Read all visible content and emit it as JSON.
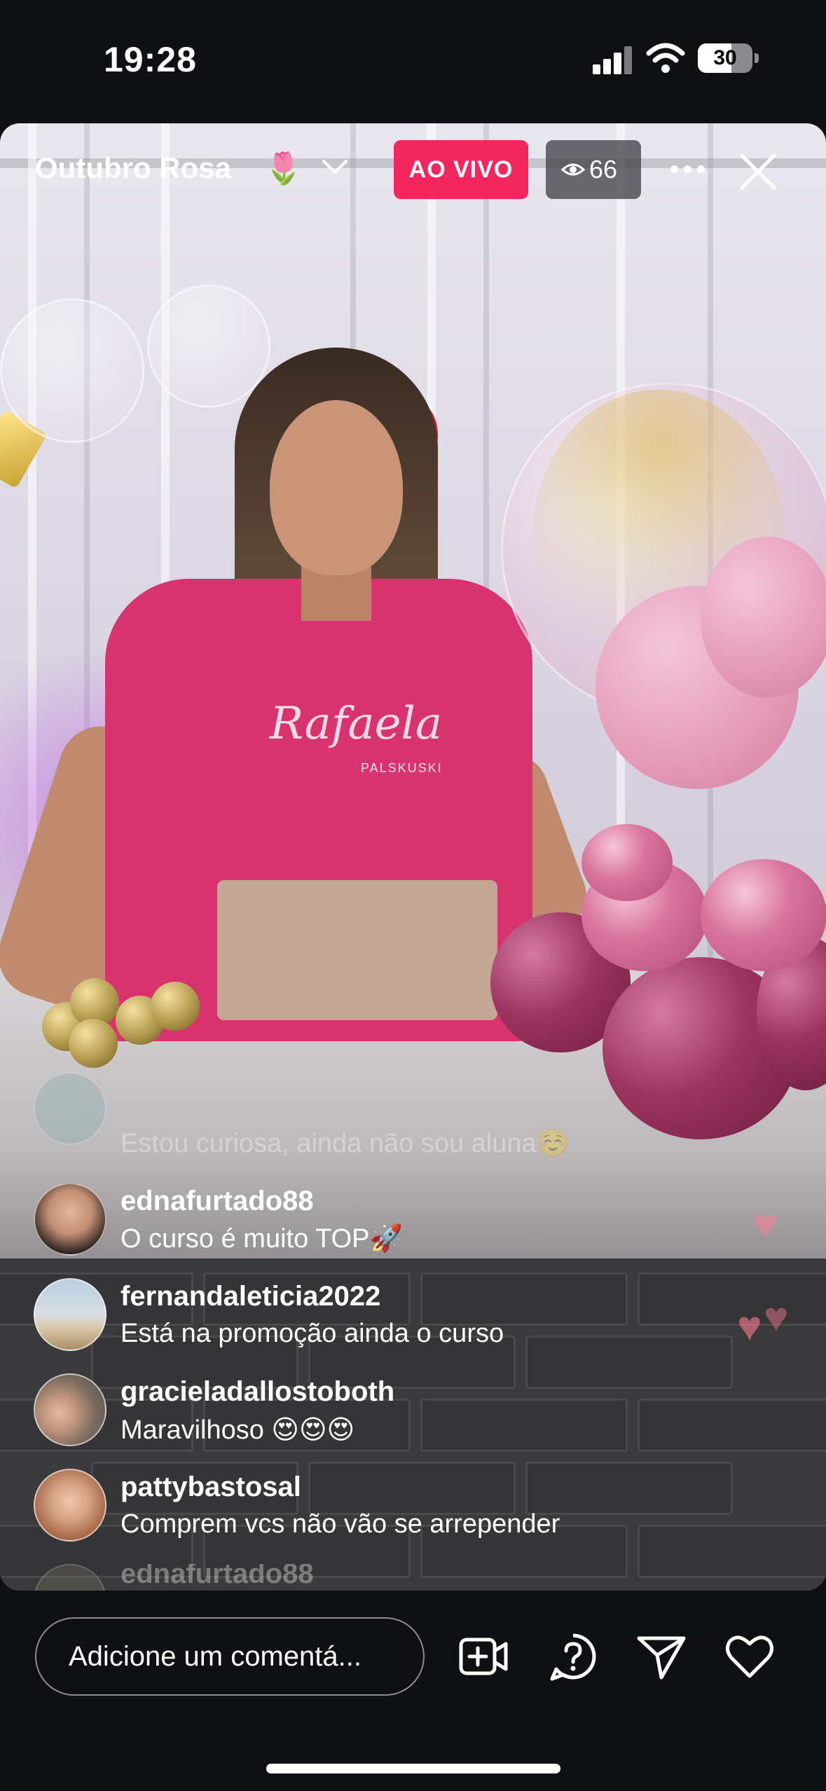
{
  "status_bar": {
    "time": "19:28",
    "battery": "30",
    "icons": [
      "cellular-signal-icon",
      "wifi-icon",
      "battery-icon"
    ]
  },
  "live": {
    "title": "Outubro Rosa",
    "title_emoji": "🌷",
    "live_badge": "AO VIVO",
    "viewer_count": "66",
    "colors": {
      "live_badge": "#f3275e",
      "views_badge": "#3c3c41"
    }
  },
  "video_overlay": {
    "shirt_logo": "Rafaela",
    "shirt_logo_sub": "PALSKUSKI"
  },
  "comments": [
    {
      "username": "",
      "text": "Estou curiosa, ainda não sou aluna☺️",
      "faded": true
    },
    {
      "username": "ednafurtado88",
      "text": "O curso é muito TOP🚀"
    },
    {
      "username": "fernandaleticia2022",
      "text": "Está na promoção ainda o curso"
    },
    {
      "username": "gracieladallostoboth",
      "text": "Maravilhoso 😍😍😍"
    },
    {
      "username": "pattybastosal",
      "text": "Comprem vcs não vão se arrepender"
    },
    {
      "username": "ednafurtado88",
      "text": "",
      "faded": true
    }
  ],
  "bottom_bar": {
    "comment_placeholder": "Adicione um comentá...",
    "icons": [
      "video-add-icon",
      "question-icon",
      "send-icon",
      "heart-icon"
    ]
  }
}
